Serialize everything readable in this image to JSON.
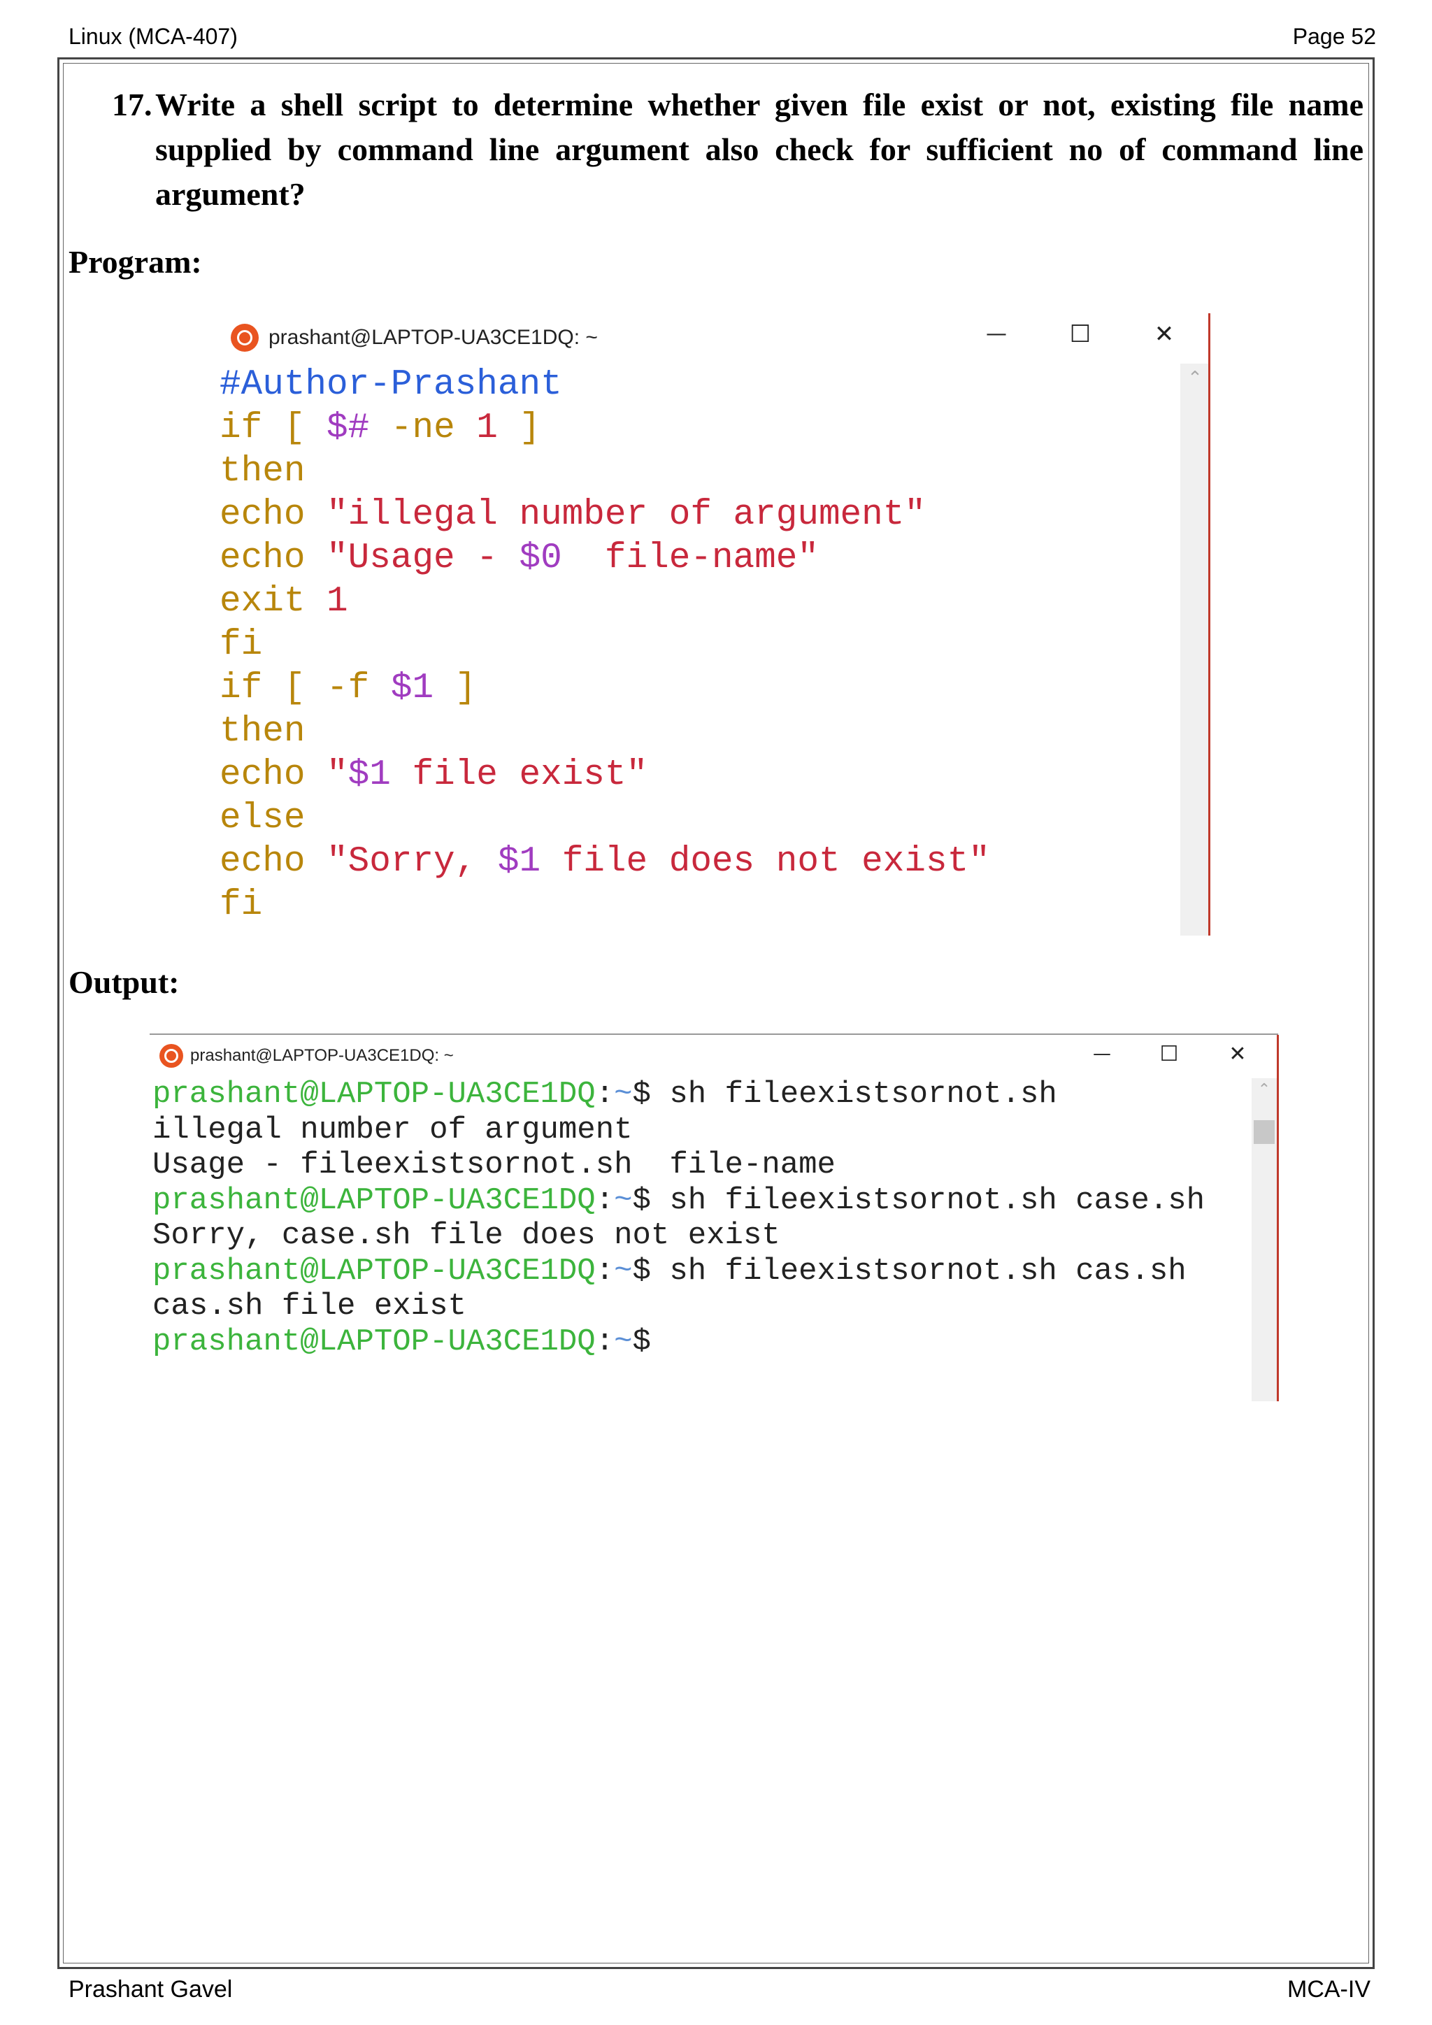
{
  "header": {
    "left": "Linux (MCA-407)",
    "right": "Page 52"
  },
  "question": {
    "number": "17.",
    "text": "Write a shell script to determine whether given file exist or not, existing file name supplied by command line argument also check for sufficient no of command line argument?"
  },
  "labels": {
    "program": "Program:",
    "output": "Output:"
  },
  "program_terminal": {
    "title": "prashant@LAPTOP-UA3CE1DQ: ~",
    "buttons": {
      "minimize": "—",
      "maximize": "☐",
      "close": "✕"
    },
    "lines": [
      [
        {
          "t": "#Author-Prashant",
          "c": "comment"
        }
      ],
      [
        {
          "t": "if [ ",
          "c": "kw"
        },
        {
          "t": "$#",
          "c": "var"
        },
        {
          "t": " -ne ",
          "c": "kw"
        },
        {
          "t": "1",
          "c": "str"
        },
        {
          "t": " ]",
          "c": "kw"
        }
      ],
      [
        {
          "t": "then",
          "c": "kw"
        }
      ],
      [
        {
          "t": "echo ",
          "c": "kw"
        },
        {
          "t": "\"illegal number of argument\"",
          "c": "str"
        }
      ],
      [
        {
          "t": "echo ",
          "c": "kw"
        },
        {
          "t": "\"Usage - ",
          "c": "str"
        },
        {
          "t": "$0",
          "c": "var"
        },
        {
          "t": "  file-name\"",
          "c": "str"
        }
      ],
      [
        {
          "t": "exit ",
          "c": "kw"
        },
        {
          "t": "1",
          "c": "str"
        }
      ],
      [
        {
          "t": "fi",
          "c": "kw"
        }
      ],
      [
        {
          "t": "if [ -f ",
          "c": "kw"
        },
        {
          "t": "$1",
          "c": "var"
        },
        {
          "t": " ]",
          "c": "kw"
        }
      ],
      [
        {
          "t": "then",
          "c": "kw"
        }
      ],
      [
        {
          "t": "echo ",
          "c": "kw"
        },
        {
          "t": "\"",
          "c": "str"
        },
        {
          "t": "$1",
          "c": "var"
        },
        {
          "t": " file exist\"",
          "c": "str"
        }
      ],
      [
        {
          "t": "else",
          "c": "kw"
        }
      ],
      [
        {
          "t": "echo ",
          "c": "kw"
        },
        {
          "t": "\"Sorry, ",
          "c": "str"
        },
        {
          "t": "$1",
          "c": "var"
        },
        {
          "t": " file does not exist\"",
          "c": "str"
        }
      ],
      [
        {
          "t": "fi",
          "c": "kw"
        }
      ]
    ]
  },
  "output_terminal": {
    "title": "prashant@LAPTOP-UA3CE1DQ: ~",
    "buttons": {
      "minimize": "—",
      "maximize": "☐",
      "close": "✕"
    },
    "lines": [
      [
        {
          "t": "prashant@LAPTOP-UA3CE1DQ",
          "c": "prompt"
        },
        {
          "t": ":",
          "c": "plain"
        },
        {
          "t": "~",
          "c": "tilde"
        },
        {
          "t": "$ sh fileexistsornot.sh",
          "c": "plain"
        }
      ],
      [
        {
          "t": "illegal number of argument",
          "c": "plain"
        }
      ],
      [
        {
          "t": "Usage - fileexistsornot.sh  file-name",
          "c": "plain"
        }
      ],
      [
        {
          "t": "prashant@LAPTOP-UA3CE1DQ",
          "c": "prompt"
        },
        {
          "t": ":",
          "c": "plain"
        },
        {
          "t": "~",
          "c": "tilde"
        },
        {
          "t": "$ sh fileexistsornot.sh case.sh",
          "c": "plain"
        }
      ],
      [
        {
          "t": "Sorry, case.sh file does not exist",
          "c": "plain"
        }
      ],
      [
        {
          "t": "prashant@LAPTOP-UA3CE1DQ",
          "c": "prompt"
        },
        {
          "t": ":",
          "c": "plain"
        },
        {
          "t": "~",
          "c": "tilde"
        },
        {
          "t": "$ sh fileexistsornot.sh cas.sh",
          "c": "plain"
        }
      ],
      [
        {
          "t": "cas.sh file exist",
          "c": "plain"
        }
      ],
      [
        {
          "t": "prashant@LAPTOP-UA3CE1DQ",
          "c": "prompt"
        },
        {
          "t": ":",
          "c": "plain"
        },
        {
          "t": "~",
          "c": "tilde"
        },
        {
          "t": "$",
          "c": "plain"
        }
      ]
    ]
  },
  "footer": {
    "left": "Prashant Gavel",
    "right": "MCA-IV"
  }
}
